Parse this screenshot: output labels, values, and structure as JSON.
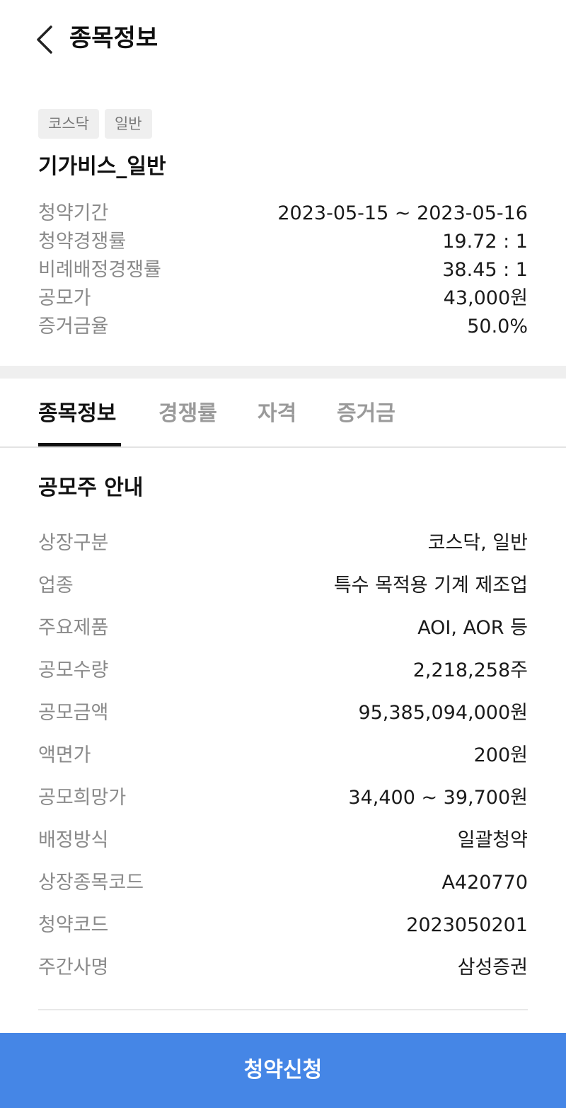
{
  "header": {
    "title": "종목정보",
    "back_icon": "chevron-left-icon"
  },
  "badges": [
    "코스닥",
    "일반"
  ],
  "stock_name": "기가비스_일반",
  "summary": [
    {
      "label": "청약기간",
      "value": "2023-05-15 ~ 2023-05-16"
    },
    {
      "label": "청약경쟁률",
      "value": "19.72 : 1"
    },
    {
      "label": "비례배정경쟁률",
      "value": "38.45 : 1"
    },
    {
      "label": "공모가",
      "value": "43,000원"
    },
    {
      "label": "증거금율",
      "value": "50.0%"
    }
  ],
  "tabs": [
    {
      "label": "종목정보",
      "active": true
    },
    {
      "label": "경쟁률",
      "active": false
    },
    {
      "label": "자격",
      "active": false
    },
    {
      "label": "증거금",
      "active": false
    }
  ],
  "section_title": "공모주 안내",
  "info": [
    {
      "label": "상장구분",
      "value": "코스닥, 일반"
    },
    {
      "label": "업종",
      "value": "특수 목적용 기계 제조업"
    },
    {
      "label": "주요제품",
      "value": "AOI, AOR 등"
    },
    {
      "label": "공모수량",
      "value": "2,218,258주"
    },
    {
      "label": "공모금액",
      "value": "95,385,094,000원"
    },
    {
      "label": "액면가",
      "value": "200원"
    },
    {
      "label": "공모희망가",
      "value": "34,400 ~ 39,700원"
    },
    {
      "label": "배정방식",
      "value": "일괄청약"
    },
    {
      "label": "상장종목코드",
      "value": "A420770"
    },
    {
      "label": "청약코드",
      "value": "2023050201"
    },
    {
      "label": "주간사명",
      "value": "삼성증권"
    }
  ],
  "apply_button": "청약신청",
  "colors": {
    "accent": "#4586e6",
    "muted_text": "#8a8a8a",
    "badge_bg": "#efefef"
  }
}
